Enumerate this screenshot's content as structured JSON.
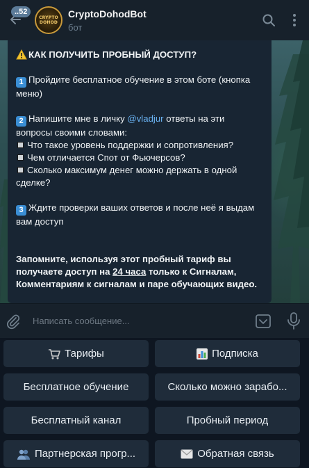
{
  "header": {
    "unread_count": "..52",
    "title": "CryptoDohodBot",
    "subtitle": "бот",
    "avatar_line1": "CRYPTO",
    "avatar_line2": "DOHOD"
  },
  "message": {
    "heading": "КАК ПОЛУЧИТЬ ПРОБНЫЙ ДОСТУП?",
    "step1": "Пройдите бесплатное обучение в этом боте (кнопка меню)",
    "step2_prefix": "Напишите мне в личку ",
    "step2_mention": "@vladjur",
    "step2_suffix": " ответы на эти вопросы своими словами:",
    "q1": "Что такое уровень поддержки и сопротивления?",
    "q2": "Чем отличается Спот от Фьючерсов?",
    "q3": "Сколько максимум денег можно держать в одной сделке?",
    "step3": "Ждите проверки ваших ответов и после неё я выдам вам доступ",
    "note_part1": "Запомните, используя этот пробный тариф вы получаете доступ на ",
    "note_link": "24 часа",
    "note_part2": " только к Сигналам, Комментариям к сигналам и паре обучающих видео.",
    "step_markers": [
      "1",
      "2",
      "3"
    ]
  },
  "input": {
    "placeholder": "Написать сообщение..."
  },
  "keyboard": {
    "tariffs": "Тарифы",
    "subscription": "Подписка",
    "free_training": "Бесплатное обучение",
    "how_much": "Сколько можно зарабо...",
    "free_channel": "Бесплатный канал",
    "trial": "Пробный период",
    "partner": "Партнерская прогр...",
    "feedback": "Обратная связь"
  },
  "colors": {
    "header_bg": "#17212b",
    "bubble_bg": "#182533",
    "mention": "#6ab3f3",
    "button_bg": "#1f2c3a",
    "keycap": "#3a8ed4"
  }
}
